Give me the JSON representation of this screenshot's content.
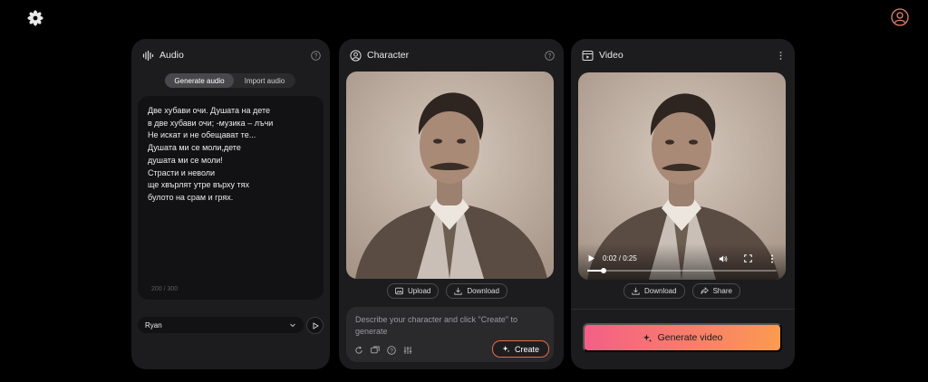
{
  "audio": {
    "title": "Audio",
    "tabs": [
      {
        "label": "Generate audio",
        "active": true
      },
      {
        "label": "Import audio",
        "active": false
      }
    ],
    "text_lines": [
      "Две хубави очи. Душата на дете",
      "в две хубави очи; -музика – лъчи",
      "Не искат и не обещават те...",
      "Душата ми се моли,дете",
      "душата ми се моли!",
      "Страсти и неволи",
      "ще хвърлят утре върху тях",
      "булото на срам и грях."
    ],
    "char_count": "200 / 300",
    "voice": "Ryan"
  },
  "character": {
    "title": "Character",
    "upload_label": "Upload",
    "download_label": "Download",
    "prompt_placeholder": "Describe your character and click \"Create\" to generate",
    "create_label": "Create"
  },
  "video": {
    "title": "Video",
    "time": "0:02 / 0:25",
    "progress_fraction": 0.087,
    "download_label": "Download",
    "share_label": "Share",
    "generate_label": "Generate video"
  },
  "colors": {
    "panel_bg": "#1c1c1e",
    "accent_orange": "#e86b4a",
    "gradient_start": "#f45f86",
    "gradient_end": "#fb9b51"
  }
}
